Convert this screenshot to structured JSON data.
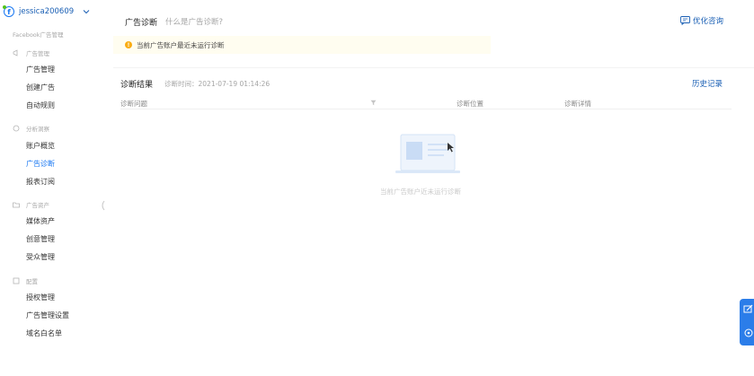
{
  "account": {
    "name": "jessica200609"
  },
  "sidebar": {
    "brand": "Facebook广告管理",
    "groups": [
      {
        "label": "广告管理",
        "icon": "megaphone-icon",
        "items": [
          "广告管理",
          "创建广告",
          "自动规则"
        ]
      },
      {
        "label": "分析洞察",
        "icon": "chart-icon",
        "items": [
          "账户概览",
          "广告诊断",
          "报表订阅"
        ]
      },
      {
        "label": "广告资产",
        "icon": "folder-icon",
        "items": [
          "媒体资产",
          "创意管理",
          "受众管理"
        ]
      },
      {
        "label": "配置",
        "icon": "settings-icon",
        "items": [
          "授权管理",
          "广告管理设置",
          "域名白名单"
        ]
      }
    ],
    "active_item": "广告诊断"
  },
  "header": {
    "title": "广告诊断",
    "subtitle": "什么是广告诊断?",
    "consult_label": "优化咨询"
  },
  "banner": {
    "text": "当前广告账户最近未运行诊断",
    "color": "#faad14"
  },
  "results": {
    "title": "诊断结果",
    "time": "诊断时间：2021-07-19 01:14:26",
    "history_label": "历史记录",
    "columns": [
      "诊断问题",
      "诊断位置",
      "诊断详情"
    ],
    "empty_text": "当前广告账户近未运行诊断"
  },
  "colors": {
    "accent": "#1877f2",
    "link": "#1a5fb4",
    "warning": "#faad14"
  }
}
